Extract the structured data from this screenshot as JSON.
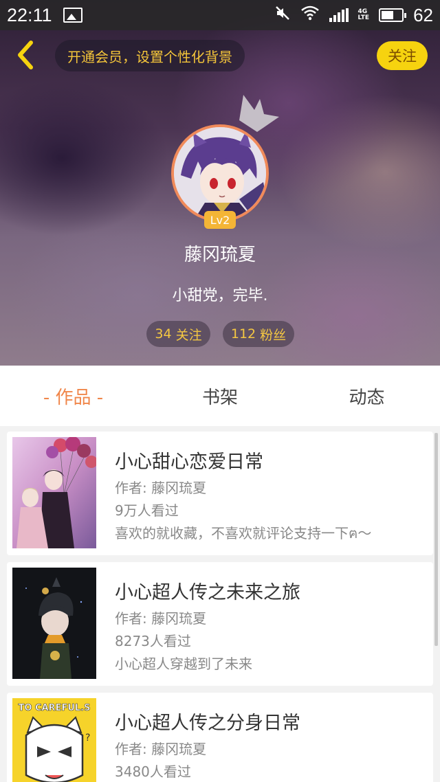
{
  "status_bar": {
    "time": "22:11",
    "battery_level": "62",
    "network": "4G LTE"
  },
  "header": {
    "back_icon": "chevron-left-icon",
    "vip_prompt": "开通会员，设置个性化背景",
    "follow_label": "关注",
    "level": "Lv2",
    "username": "藤冈琉夏",
    "bio": "小甜党，完毕.",
    "following_count": "34",
    "following_label": "关注",
    "fans_count": "112",
    "fans_label": "粉丝"
  },
  "tabs": [
    {
      "label": "- 作品 -",
      "active": true
    },
    {
      "label": "书架",
      "active": false
    },
    {
      "label": "动态",
      "active": false
    }
  ],
  "works": [
    {
      "title": "小心甜心恋爱日常",
      "author": "作者: 藤冈琉夏",
      "views": "9万人看过",
      "desc": "喜欢的就收藏，不喜欢就评论支持一下ฅ～"
    },
    {
      "title": "小心超人传之未来之旅",
      "author": "作者: 藤冈琉夏",
      "views": "8273人看过",
      "desc": "小心超人穿越到了未来"
    },
    {
      "title": "小心超人传之分身日常",
      "author": "作者: 藤冈琉夏",
      "views": "3480人看过",
      "desc": "",
      "cover_text": "TO CAREFUL.S"
    }
  ],
  "colors": {
    "accent": "#f0864a",
    "follow_button": "#f6d30f",
    "stat_text": "#f5c842"
  }
}
